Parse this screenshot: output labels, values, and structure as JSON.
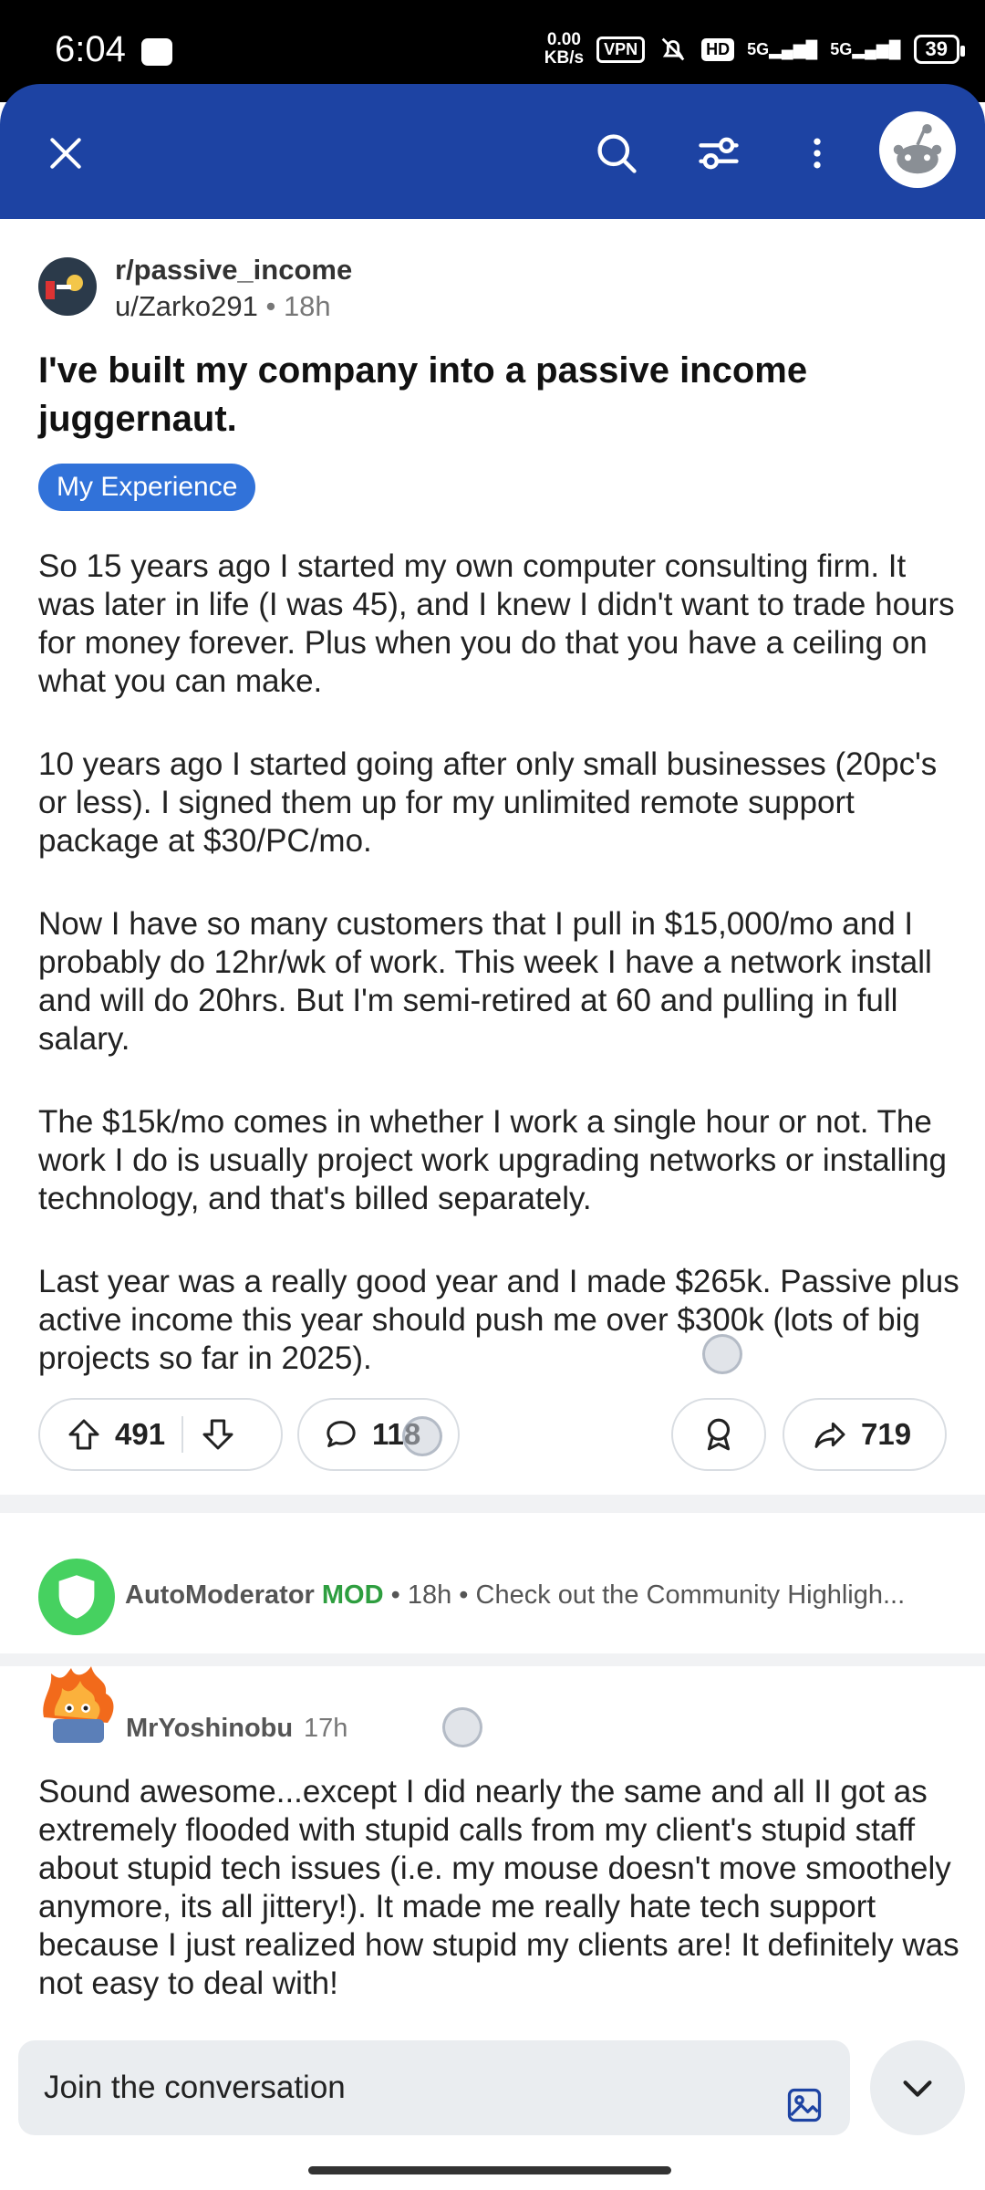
{
  "status_bar": {
    "time": "6:04",
    "net_speed_value": "0.00",
    "net_speed_unit": "KB/s",
    "vpn": "VPN",
    "hd": "HD",
    "sig1": "5G",
    "sig2": "5G",
    "battery": "39"
  },
  "header": {
    "close_icon": "close-icon",
    "search_icon": "search-icon",
    "sort_icon": "sort-filter-icon",
    "more_icon": "more-vertical-icon",
    "avatar": "user-avatar"
  },
  "post": {
    "subreddit": "r/passive_income",
    "author": "u/Zarko291",
    "dot": "•",
    "time": "18h",
    "title": "I've built my company into a passive income juggernaut.",
    "flair": "My Experience",
    "paragraphs": [
      "So 15 years ago I started my own computer consulting firm. It was later in life (I was 45), and I knew I didn't want to trade hours for money forever. Plus when you do that you have a ceiling on what you can make.",
      "10 years ago I started going after only small businesses (20pc's or less). I signed them up for my unlimited remote support package at $30/PC/mo.",
      "Now I have so many customers that I pull in $15,000/mo and I probably do 12hr/wk of work. This week I have a network install and will do 20hrs. But I'm semi-retired at 60 and pulling in full salary.",
      "The $15k/mo comes in whether I work a single hour or not. The work I do is usually project work upgrading networks or installing technology, and that's billed separately.",
      "Last year was a really good year and I made $265k. Passive plus active income this year should push me over $300k (lots of big projects so far in 2025)."
    ],
    "upvotes": "491",
    "comments": "118",
    "shares": "719"
  },
  "automod": {
    "user": "AutoModerator",
    "mod_tag": "MOD",
    "time": "• 18h •",
    "preview": "Check out the Community Highligh..."
  },
  "comment": {
    "author": "MrYoshinobu",
    "time": "17h",
    "body": "Sound awesome...except I did nearly the same and all II got as extremely flooded with stupid calls from my client's stupid staff about stupid tech issues (i.e. my mouse doesn't move smoothely anymore, its all jittery!). It made me really hate tech support because I just realized how stupid my clients are! It definitely was not easy to deal with!"
  },
  "bottom": {
    "join_placeholder": "Join the conversation"
  },
  "colors": {
    "header_bg": "#1d43a3",
    "flair_bg": "#3172d9",
    "mod_green": "#2e9e3f",
    "automod_avatar": "#46d160"
  }
}
